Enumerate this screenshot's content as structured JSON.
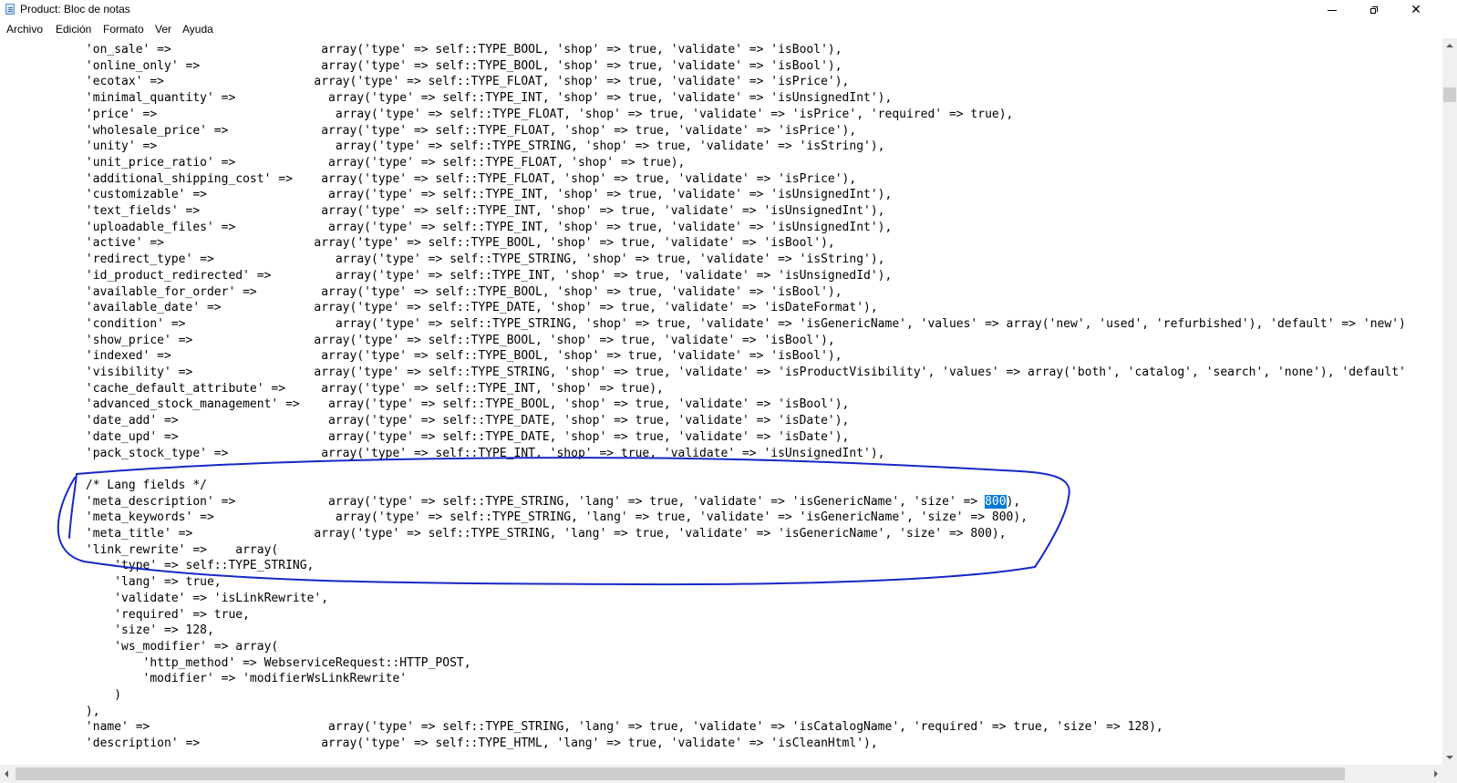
{
  "window": {
    "title": "Product: Bloc de notas",
    "icon": "notepad-icon",
    "controls": {
      "minimize_icon": "minimize-icon",
      "maximize_icon": "restore-icon",
      "close_glyph": "✕"
    }
  },
  "menu": [
    "Archivo",
    "Edición",
    "Formato",
    "Ver",
    "Ayuda"
  ],
  "editor": {
    "selected_text": "800",
    "lines": [
      "            'on_sale' =>                     array('type' => self::TYPE_BOOL, 'shop' => true, 'validate' => 'isBool'),",
      "            'online_only' =>                 array('type' => self::TYPE_BOOL, 'shop' => true, 'validate' => 'isBool'),",
      "            'ecotax' =>                     array('type' => self::TYPE_FLOAT, 'shop' => true, 'validate' => 'isPrice'),",
      "            'minimal_quantity' =>             array('type' => self::TYPE_INT, 'shop' => true, 'validate' => 'isUnsignedInt'),",
      "            'price' =>                         array('type' => self::TYPE_FLOAT, 'shop' => true, 'validate' => 'isPrice', 'required' => true),",
      "            'wholesale_price' =>             array('type' => self::TYPE_FLOAT, 'shop' => true, 'validate' => 'isPrice'),",
      "            'unity' =>                         array('type' => self::TYPE_STRING, 'shop' => true, 'validate' => 'isString'),",
      "            'unit_price_ratio' =>             array('type' => self::TYPE_FLOAT, 'shop' => true),",
      "            'additional_shipping_cost' =>    array('type' => self::TYPE_FLOAT, 'shop' => true, 'validate' => 'isPrice'),",
      "            'customizable' =>                 array('type' => self::TYPE_INT, 'shop' => true, 'validate' => 'isUnsignedInt'),",
      "            'text_fields' =>                 array('type' => self::TYPE_INT, 'shop' => true, 'validate' => 'isUnsignedInt'),",
      "            'uploadable_files' =>             array('type' => self::TYPE_INT, 'shop' => true, 'validate' => 'isUnsignedInt'),",
      "            'active' =>                     array('type' => self::TYPE_BOOL, 'shop' => true, 'validate' => 'isBool'),",
      "            'redirect_type' =>                 array('type' => self::TYPE_STRING, 'shop' => true, 'validate' => 'isString'),",
      "            'id_product_redirected' =>         array('type' => self::TYPE_INT, 'shop' => true, 'validate' => 'isUnsignedId'),",
      "            'available_for_order' =>         array('type' => self::TYPE_BOOL, 'shop' => true, 'validate' => 'isBool'),",
      "            'available_date' =>             array('type' => self::TYPE_DATE, 'shop' => true, 'validate' => 'isDateFormat'),",
      "            'condition' =>                     array('type' => self::TYPE_STRING, 'shop' => true, 'validate' => 'isGenericName', 'values' => array('new', 'used', 'refurbished'), 'default' => 'new')",
      "            'show_price' =>                 array('type' => self::TYPE_BOOL, 'shop' => true, 'validate' => 'isBool'),",
      "            'indexed' =>                     array('type' => self::TYPE_BOOL, 'shop' => true, 'validate' => 'isBool'),",
      "            'visibility' =>                 array('type' => self::TYPE_STRING, 'shop' => true, 'validate' => 'isProductVisibility', 'values' => array('both', 'catalog', 'search', 'none'), 'default'",
      "            'cache_default_attribute' =>     array('type' => self::TYPE_INT, 'shop' => true),",
      "            'advanced_stock_management' =>    array('type' => self::TYPE_BOOL, 'shop' => true, 'validate' => 'isBool'),",
      "            'date_add' =>                     array('type' => self::TYPE_DATE, 'shop' => true, 'validate' => 'isDate'),",
      "            'date_upd' =>                     array('type' => self::TYPE_DATE, 'shop' => true, 'validate' => 'isDate'),",
      "            'pack_stock_type' =>             array('type' => self::TYPE_INT, 'shop' => true, 'validate' => 'isUnsignedInt'),",
      "",
      "            /* Lang fields */",
      "            'meta_description' =>             array('type' => self::TYPE_STRING, 'lang' => true, 'validate' => 'isGenericName', 'size' => 800),",
      "            'meta_keywords' =>                 array('type' => self::TYPE_STRING, 'lang' => true, 'validate' => 'isGenericName', 'size' => 800),",
      "            'meta_title' =>                 array('type' => self::TYPE_STRING, 'lang' => true, 'validate' => 'isGenericName', 'size' => 800),",
      "            'link_rewrite' =>    array(",
      "                'type' => self::TYPE_STRING,",
      "                'lang' => true,",
      "                'validate' => 'isLinkRewrite',",
      "                'required' => true,",
      "                'size' => 128,",
      "                'ws_modifier' => array(",
      "                    'http_method' => WebserviceRequest::HTTP_POST,",
      "                    'modifier' => 'modifierWsLinkRewrite'",
      "                )",
      "            ),",
      "            'name' =>                         array('type' => self::TYPE_STRING, 'lang' => true, 'validate' => 'isCatalogName', 'required' => true, 'size' => 128),",
      "            'description' =>                 array('type' => self::TYPE_HTML, 'lang' => true, 'validate' => 'isCleanHtml'),"
    ]
  },
  "annotation": {
    "color": "#1428c8",
    "shape": "hand-drawn-ellipse"
  }
}
